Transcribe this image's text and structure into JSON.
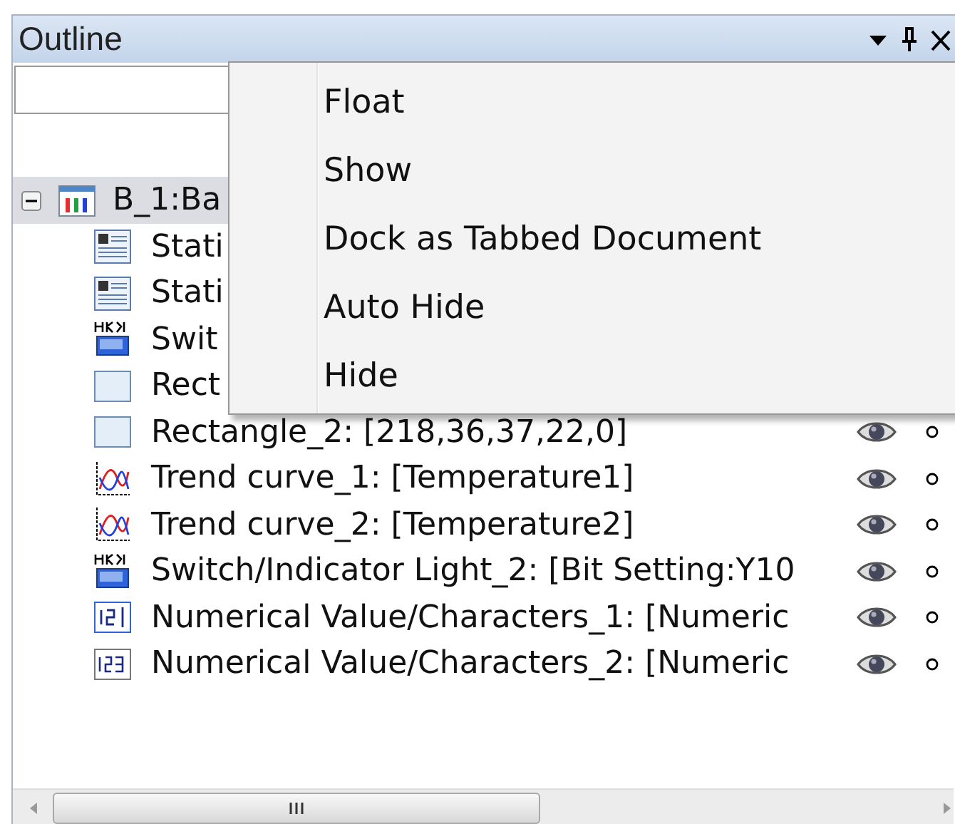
{
  "panel": {
    "title": "Outline"
  },
  "tree": [
    {
      "label": "B_1:Ba",
      "kind": "screen",
      "selected": true,
      "expanded": true,
      "children": [
        {
          "label": "Stati",
          "kind": "text",
          "selected": false
        },
        {
          "label": "Stati",
          "kind": "text",
          "selected": false
        },
        {
          "label": "Swit",
          "kind": "switch",
          "selected": false
        },
        {
          "label": "Rect",
          "kind": "rectangle",
          "selected": false
        },
        {
          "label": "Rectangle_2: [218,36,37,22,0]",
          "kind": "rectangle",
          "selected": false
        },
        {
          "label": "Trend curve_1: [Temperature1]",
          "kind": "trend",
          "selected": false
        },
        {
          "label": "Trend curve_2: [Temperature2]",
          "kind": "trend",
          "selected": false
        },
        {
          "label": "Switch/Indicator Light_2: [Bit Setting:Y10",
          "kind": "switch",
          "selected": false
        },
        {
          "label": "Numerical Value/Characters_1: [Numeric",
          "kind": "number-edit",
          "selected": false
        },
        {
          "label": "Numerical Value/Characters_2: [Numeric",
          "kind": "number",
          "selected": false
        }
      ]
    }
  ],
  "context_menu": [
    "Float",
    "Show",
    "Dock as Tabbed Document",
    "Auto Hide",
    "Hide"
  ]
}
